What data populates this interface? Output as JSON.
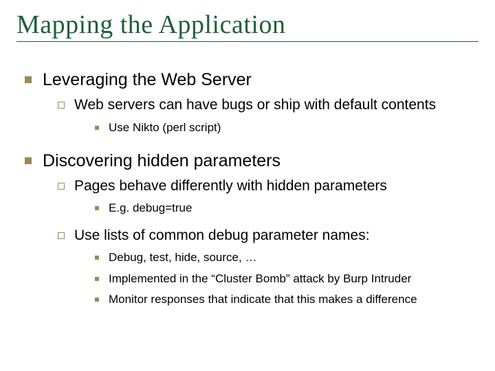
{
  "title": "Mapping the Application",
  "b1": {
    "text": "Leveraging the Web Server",
    "sub": [
      {
        "text": "Web servers can have bugs or ship with default contents",
        "sub": [
          {
            "text": "Use Nikto (perl script)"
          }
        ]
      }
    ]
  },
  "b2": {
    "text": "Discovering hidden parameters",
    "sub": [
      {
        "text": "Pages behave differently with hidden parameters",
        "sub": [
          {
            "text": "E.g. debug=true"
          }
        ]
      },
      {
        "text": "Use lists of common debug parameter names:",
        "sub": [
          {
            "text": "Debug, test, hide, source, …"
          },
          {
            "text": "Implemented in the “Cluster Bomb” attack by Burp Intruder"
          },
          {
            "text": "Monitor responses that indicate that this makes a difference"
          }
        ]
      }
    ]
  }
}
